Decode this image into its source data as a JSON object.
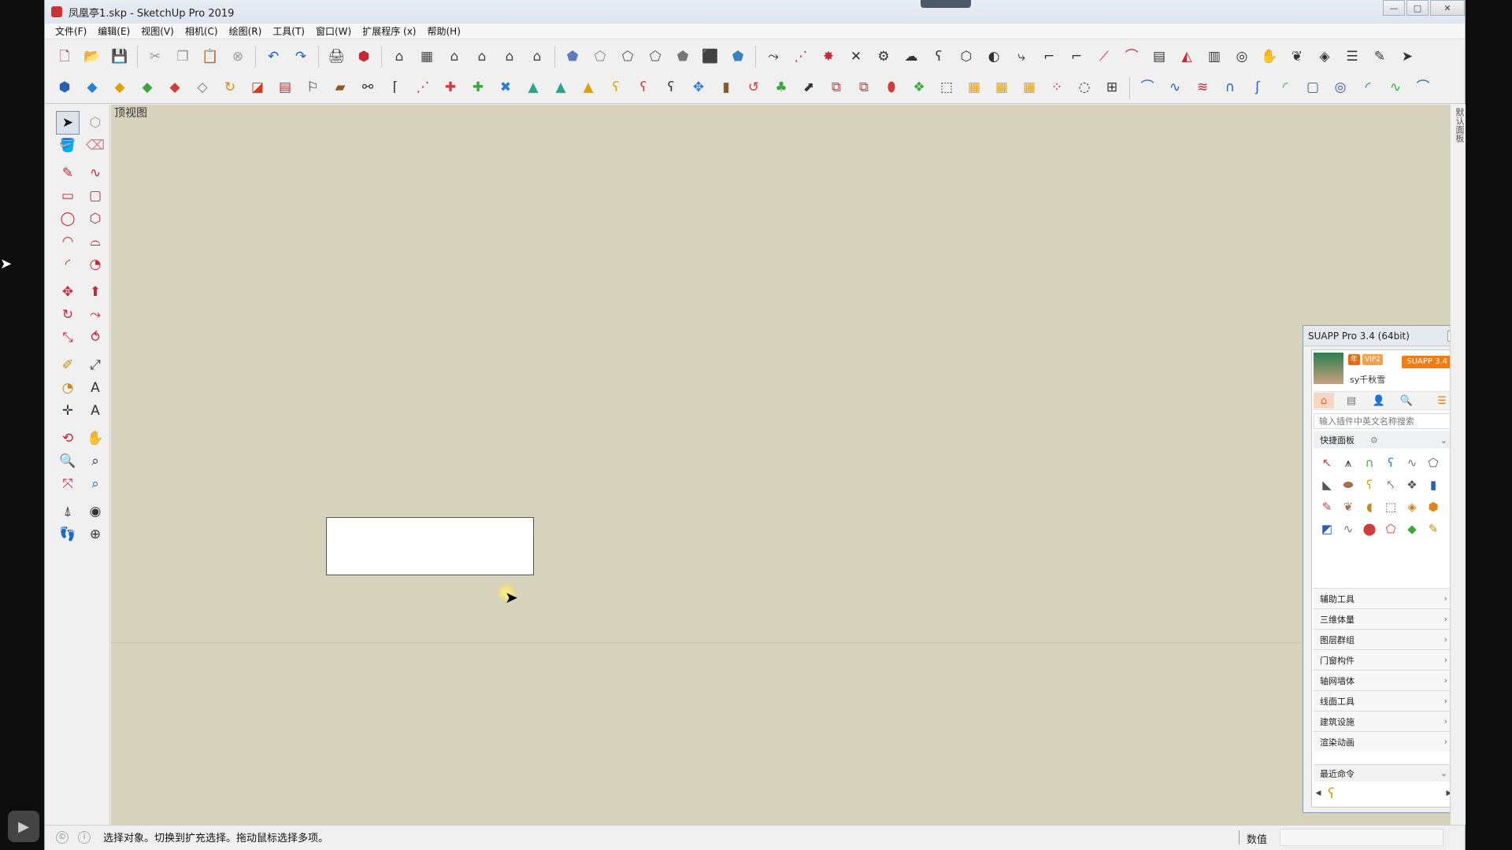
{
  "window": {
    "title": "凤凰亭1.skp - SketchUp Pro 2019",
    "controls": {
      "minimize": "—",
      "maximize": "□",
      "close": "✕"
    }
  },
  "menu": [
    "文件(F)",
    "编辑(E)",
    "视图(V)",
    "相机(C)",
    "绘图(R)",
    "工具(T)",
    "窗口(W)",
    "扩展程序 (x)",
    "帮助(H)"
  ],
  "toolbar1": [
    {
      "name": "new-icon",
      "glyph": "🗋",
      "color": "#c2283a"
    },
    {
      "name": "open-icon",
      "glyph": "📂",
      "color": "#555555"
    },
    {
      "name": "save-icon",
      "glyph": "💾",
      "color": "#2a5c9b"
    },
    {
      "sep": true
    },
    {
      "name": "cut-icon",
      "glyph": "✂",
      "color": "#999999"
    },
    {
      "name": "copy-icon",
      "glyph": "❐",
      "color": "#999999"
    },
    {
      "name": "paste-icon",
      "glyph": "📋",
      "color": "#999999"
    },
    {
      "name": "erase-icon",
      "glyph": "⊗",
      "color": "#999999"
    },
    {
      "sep": true
    },
    {
      "name": "undo-icon",
      "glyph": "↶",
      "color": "#1f5fb0"
    },
    {
      "name": "redo-icon",
      "glyph": "↷",
      "color": "#1f5fb0"
    },
    {
      "sep": true
    },
    {
      "name": "print-icon",
      "glyph": "🖨",
      "color": "#333333"
    },
    {
      "name": "model-info-icon",
      "glyph": "⬢",
      "color": "#c2283a"
    },
    {
      "sep": true
    },
    {
      "name": "iso-view-icon",
      "glyph": "⌂",
      "color": "#444444"
    },
    {
      "name": "top-view-icon",
      "glyph": "▦",
      "color": "#444444"
    },
    {
      "name": "front-view-icon",
      "glyph": "⌂",
      "color": "#444444"
    },
    {
      "name": "right-view-icon",
      "glyph": "⌂",
      "color": "#444444"
    },
    {
      "name": "back-view-icon",
      "glyph": "⌂",
      "color": "#444444"
    },
    {
      "name": "left-view-icon",
      "glyph": "⌂",
      "color": "#444444"
    },
    {
      "sep": true
    },
    {
      "name": "xray-icon",
      "glyph": "⬟",
      "color": "#5b7fb5"
    },
    {
      "name": "back-edges-icon",
      "glyph": "⬠",
      "color": "#888888"
    },
    {
      "name": "wireframe-icon",
      "glyph": "⬠",
      "color": "#555555"
    },
    {
      "name": "hidden-line-icon",
      "glyph": "⬠",
      "color": "#555555"
    },
    {
      "name": "shaded-icon",
      "glyph": "⬟",
      "color": "#777777"
    },
    {
      "name": "shaded-textures-icon",
      "glyph": "⬛",
      "color": "#444444"
    },
    {
      "name": "monochrome-icon",
      "glyph": "⬟",
      "color": "#3e7fc4"
    },
    {
      "sep": true
    },
    {
      "name": "follow-me-icon",
      "glyph": "⤳",
      "color": "#333333"
    },
    {
      "name": "polyline-icon",
      "glyph": "⋰",
      "color": "#c2283a"
    },
    {
      "name": "sandbox-icon",
      "glyph": "✸",
      "color": "#c2283a"
    },
    {
      "name": "intersect-icon",
      "glyph": "✕",
      "color": "#333333"
    },
    {
      "name": "gear-shape-icon",
      "glyph": "⚙",
      "color": "#333333"
    },
    {
      "name": "shell-icon",
      "glyph": "☁",
      "color": "#333333"
    },
    {
      "name": "hook-icon",
      "glyph": "ʕ",
      "color": "#333333"
    },
    {
      "name": "solid-icon",
      "glyph": "⬡",
      "color": "#333333"
    },
    {
      "name": "split-icon",
      "glyph": "◐",
      "color": "#333333"
    },
    {
      "name": "trim-icon",
      "glyph": "⤷",
      "color": "#333333"
    },
    {
      "name": "fillet-icon",
      "glyph": "⌐",
      "color": "#333333"
    },
    {
      "name": "chamfer-icon",
      "glyph": "⌐",
      "color": "#333333"
    },
    {
      "name": "line-red-icon",
      "glyph": "⟋",
      "color": "#c2283a"
    },
    {
      "name": "curve-icon",
      "glyph": "⌒",
      "color": "#c2283a"
    },
    {
      "name": "grid-icon",
      "glyph": "▤",
      "color": "#333333"
    },
    {
      "name": "slice-icon",
      "glyph": "◭",
      "color": "#c2283a"
    },
    {
      "name": "stairs-icon",
      "glyph": "▥",
      "color": "#333333"
    },
    {
      "name": "spiral-icon",
      "glyph": "◎",
      "color": "#333333"
    },
    {
      "name": "hand-icon",
      "glyph": "✋",
      "color": "#333333"
    },
    {
      "name": "leaf-icon",
      "glyph": "❦",
      "color": "#333333"
    },
    {
      "name": "cut-plane-icon",
      "glyph": "◈",
      "color": "#333333"
    },
    {
      "name": "layers-icon",
      "glyph": "☰",
      "color": "#333333"
    },
    {
      "name": "pen-icon",
      "glyph": "✎",
      "color": "#333333"
    },
    {
      "name": "arrow-tool-icon",
      "glyph": "➤",
      "color": "#333333"
    }
  ],
  "toolbar2": [
    {
      "name": "component-icon",
      "glyph": "⬢",
      "color": "#2a5fb0"
    },
    {
      "name": "plane-blue-icon",
      "glyph": "◆",
      "color": "#2a7fd4"
    },
    {
      "name": "plane-yellow-icon",
      "glyph": "◆",
      "color": "#d7a400"
    },
    {
      "name": "plane-green-icon",
      "glyph": "◆",
      "color": "#3ea63e"
    },
    {
      "name": "plane-red-icon",
      "glyph": "◆",
      "color": "#d23b3b"
    },
    {
      "name": "plane-white-icon",
      "glyph": "◇",
      "color": "#777777"
    },
    {
      "name": "rotate-orange-icon",
      "glyph": "↻",
      "color": "#e0831c"
    },
    {
      "name": "square-red-icon",
      "glyph": "◪",
      "color": "#d83a1a"
    },
    {
      "name": "window-icon",
      "glyph": "▤",
      "color": "#b03030"
    },
    {
      "name": "flag-icon",
      "glyph": "⚐",
      "color": "#333333"
    },
    {
      "name": "box-icon",
      "glyph": "▰",
      "color": "#8a5a2b"
    },
    {
      "name": "link-icon",
      "glyph": "⚯",
      "color": "#333333"
    },
    {
      "name": "curve-tool-icon",
      "glyph": "⌈",
      "color": "#333333"
    },
    {
      "name": "node-icon",
      "glyph": "⋰",
      "color": "#c2283a"
    },
    {
      "name": "cross-red-icon",
      "glyph": "✚",
      "color": "#d23b3b"
    },
    {
      "name": "cross-green-icon",
      "glyph": "✚",
      "color": "#3ea63e"
    },
    {
      "name": "cross-blue-icon",
      "glyph": "✖",
      "color": "#2a7fd4"
    },
    {
      "name": "cone-icon",
      "glyph": "▲",
      "color": "#2aa58a"
    },
    {
      "name": "cone-stack-icon",
      "glyph": "▲",
      "color": "#2aa58a"
    },
    {
      "name": "pyramid-icon",
      "glyph": "▲",
      "color": "#d7a400"
    },
    {
      "name": "hook-yellow-icon",
      "glyph": "ʕ",
      "color": "#d7a400"
    },
    {
      "name": "hook-red-icon",
      "glyph": "ʕ",
      "color": "#d23b3b"
    },
    {
      "name": "loop-icon",
      "glyph": "ʕ",
      "color": "#333333"
    },
    {
      "name": "move-cross-icon",
      "glyph": "✥",
      "color": "#2a7fd4"
    },
    {
      "name": "bucket-icon",
      "glyph": "▮",
      "color": "#8a5a2b"
    },
    {
      "name": "return-icon",
      "glyph": "↺",
      "color": "#d23b3b"
    },
    {
      "name": "tree-icon",
      "glyph": "♣",
      "color": "#3ea63e"
    },
    {
      "name": "move-box-icon",
      "glyph": "⬈",
      "color": "#333333"
    },
    {
      "name": "merge-icon",
      "glyph": "⧉",
      "color": "#d23b3b"
    },
    {
      "name": "split-box-icon",
      "glyph": "⧉",
      "color": "#d23b3b"
    },
    {
      "name": "paint-icon",
      "glyph": "⬮",
      "color": "#d23b3b"
    },
    {
      "name": "pattern-icon",
      "glyph": "❖",
      "color": "#3ea63e"
    },
    {
      "name": "frame-icon",
      "glyph": "⬚",
      "color": "#333333"
    },
    {
      "name": "grid-yellow-icon",
      "glyph": "▦",
      "color": "#e0a21c"
    },
    {
      "name": "grid-yellow-2-icon",
      "glyph": "▦",
      "color": "#e0a21c"
    },
    {
      "name": "grid-yellow-3-icon",
      "glyph": "▦",
      "color": "#e0a21c"
    },
    {
      "name": "explode-icon",
      "glyph": "⁘",
      "color": "#c2283a"
    },
    {
      "name": "dots-circle-icon",
      "glyph": "◌",
      "color": "#333333"
    },
    {
      "name": "array-icon",
      "glyph": "⊞",
      "color": "#333333"
    },
    {
      "sep": true
    },
    {
      "name": "arc-blue-icon",
      "glyph": "⌒",
      "color": "#2a5fb0"
    },
    {
      "name": "line-zigzag-icon",
      "glyph": "∿",
      "color": "#2a5fb0"
    },
    {
      "name": "multi-line-icon",
      "glyph": "≋",
      "color": "#c2283a"
    },
    {
      "name": "n-curve-icon",
      "glyph": "∩",
      "color": "#2a5fb0"
    },
    {
      "name": "s-curve-icon",
      "glyph": "ʃ",
      "color": "#2a5fb0"
    },
    {
      "name": "green-arc-icon",
      "glyph": "◜",
      "color": "#3ea63e"
    },
    {
      "name": "rounded-rect-icon",
      "glyph": "▢",
      "color": "#2a5fb0"
    },
    {
      "name": "spiral-blue-icon",
      "glyph": "◎",
      "color": "#2a5fb0"
    },
    {
      "name": "arc-2-icon",
      "glyph": "◜",
      "color": "#2a5fb0"
    },
    {
      "name": "green-line-icon",
      "glyph": "∿",
      "color": "#3ea63e"
    },
    {
      "name": "hook-blue-icon",
      "glyph": "⌒",
      "color": "#2a5fb0"
    }
  ],
  "left_tools": [
    [
      {
        "name": "select-tool-icon",
        "glyph": "➤",
        "color": "#111111",
        "active": true
      },
      {
        "name": "make-component-icon",
        "glyph": "⬡",
        "color": "#999999"
      }
    ],
    [
      {
        "name": "paint-bucket-icon",
        "glyph": "🪣",
        "color": "#c08a20"
      },
      {
        "name": "eraser-icon",
        "glyph": "⌫",
        "color": "#d77a8a"
      }
    ],
    [
      {
        "name": "line-tool-icon",
        "glyph": "✎",
        "color": "#c2283a"
      },
      {
        "name": "freehand-icon",
        "glyph": "∿",
        "color": "#c2283a"
      }
    ],
    [
      {
        "name": "rectangle-tool-icon",
        "glyph": "▭",
        "color": "#c2283a"
      },
      {
        "name": "rotated-rect-icon",
        "glyph": "▢",
        "color": "#c2283a"
      }
    ],
    [
      {
        "name": "circle-tool-icon",
        "glyph": "◯",
        "color": "#c2283a"
      },
      {
        "name": "polygon-tool-icon",
        "glyph": "⬡",
        "color": "#c2283a"
      }
    ],
    [
      {
        "name": "arc-tool-icon",
        "glyph": "◠",
        "color": "#c2283a"
      },
      {
        "name": "two-point-arc-icon",
        "glyph": "⌓",
        "color": "#c2283a"
      }
    ],
    [
      {
        "name": "three-point-arc-icon",
        "glyph": "◜",
        "color": "#c2283a"
      },
      {
        "name": "pie-tool-icon",
        "glyph": "◔",
        "color": "#c2283a"
      }
    ],
    [
      {
        "name": "move-tool-icon",
        "glyph": "✥",
        "color": "#c2283a"
      },
      {
        "name": "push-pull-icon",
        "glyph": "⬆",
        "color": "#c2283a"
      }
    ],
    [
      {
        "name": "rotate-tool-icon",
        "glyph": "↻",
        "color": "#c2283a"
      },
      {
        "name": "follow-me-tool-icon",
        "glyph": "⤳",
        "color": "#c2283a"
      }
    ],
    [
      {
        "name": "scale-tool-icon",
        "glyph": "⤡",
        "color": "#c2283a"
      },
      {
        "name": "offset-tool-icon",
        "glyph": "⥀",
        "color": "#c2283a"
      }
    ],
    [
      {
        "name": "tape-measure-icon",
        "glyph": "✐",
        "color": "#c08a20"
      },
      {
        "name": "dimension-icon",
        "glyph": "⤢",
        "color": "#333333"
      }
    ],
    [
      {
        "name": "protractor-icon",
        "glyph": "◔",
        "color": "#c08a20"
      },
      {
        "name": "text-tool-icon",
        "glyph": "A",
        "color": "#333333"
      }
    ],
    [
      {
        "name": "axes-tool-icon",
        "glyph": "✛",
        "color": "#333333"
      },
      {
        "name": "3d-text-icon",
        "glyph": "A",
        "color": "#333333"
      }
    ],
    [
      {
        "name": "orbit-tool-icon",
        "glyph": "⟲",
        "color": "#c2283a"
      },
      {
        "name": "pan-tool-icon",
        "glyph": "✋",
        "color": "#c08a20"
      }
    ],
    [
      {
        "name": "zoom-tool-icon",
        "glyph": "🔍",
        "color": "#333333"
      },
      {
        "name": "zoom-window-icon",
        "glyph": "⌕",
        "color": "#333333"
      }
    ],
    [
      {
        "name": "zoom-extents-icon",
        "glyph": "⤧",
        "color": "#c2283a"
      },
      {
        "name": "previous-view-icon",
        "glyph": "⌕",
        "color": "#2a5fb0"
      }
    ],
    [
      {
        "name": "position-camera-icon",
        "glyph": "⍋",
        "color": "#333333"
      },
      {
        "name": "look-around-icon",
        "glyph": "◉",
        "color": "#333333"
      }
    ],
    [
      {
        "name": "walk-tool-icon",
        "glyph": "👣",
        "color": "#333333"
      },
      {
        "name": "section-plane-icon",
        "glyph": "⊕",
        "color": "#333333"
      }
    ]
  ],
  "viewport": {
    "label": "顶视图",
    "background": "#d7d2bc"
  },
  "right_strip": "默认面板",
  "suapp": {
    "title": "SUAPP Pro 3.4 (64bit)",
    "close": "x",
    "badge_year": "年",
    "badge_vip": "VIP2",
    "badge_version": "SUAPP 3.4",
    "username": "sy千秋雪",
    "tabs": [
      "⌂",
      "▤",
      "👤",
      "🔍",
      "☰"
    ],
    "search_placeholder": "输入插件中英文名称搜索",
    "quick_panel": "快捷面板",
    "quick_icons": [
      {
        "glyph": "↖",
        "color": "#d23b3b"
      },
      {
        "glyph": "⩚",
        "color": "#333333"
      },
      {
        "glyph": "∩",
        "color": "#3ea63e"
      },
      {
        "glyph": "ʕ",
        "color": "#2a7fd4"
      },
      {
        "glyph": "∿",
        "color": "#777777"
      },
      {
        "glyph": "⬠",
        "color": "#555555"
      },
      {
        "glyph": "◣",
        "color": "#555555"
      },
      {
        "glyph": "⬬",
        "color": "#a07050"
      },
      {
        "glyph": "ʕ",
        "color": "#d7a400"
      },
      {
        "glyph": "⤣",
        "color": "#555555"
      },
      {
        "glyph": "❖",
        "color": "#555555"
      },
      {
        "glyph": "▮",
        "color": "#2a5fb0"
      },
      {
        "glyph": "✎",
        "color": "#d23b3b"
      },
      {
        "glyph": "❦",
        "color": "#a07050"
      },
      {
        "glyph": "◖",
        "color": "#c08a20"
      },
      {
        "glyph": "⬚",
        "color": "#555555"
      },
      {
        "glyph": "◈",
        "color": "#c08a20"
      },
      {
        "glyph": "⬢",
        "color": "#e0831c"
      },
      {
        "glyph": "◩",
        "color": "#2a5fb0"
      },
      {
        "glyph": "∿",
        "color": "#777777"
      },
      {
        "glyph": "⬤",
        "color": "#d23b3b"
      },
      {
        "glyph": "⬠",
        "color": "#d23b3b"
      },
      {
        "glyph": "◆",
        "color": "#3ea63e"
      },
      {
        "glyph": "✎",
        "color": "#c08a20"
      }
    ],
    "categories": [
      "辅助工具",
      "三维体量",
      "图层群组",
      "门窗构件",
      "轴网墙体",
      "线面工具",
      "建筑设施",
      "渲染动画"
    ],
    "recent_label": "最近命令",
    "recent_tool": "ʕ"
  },
  "status": {
    "text": "选择对象。切换到扩充选择。拖动鼠标选择多项。",
    "vcb_label": "数值",
    "vcb_value": ""
  }
}
